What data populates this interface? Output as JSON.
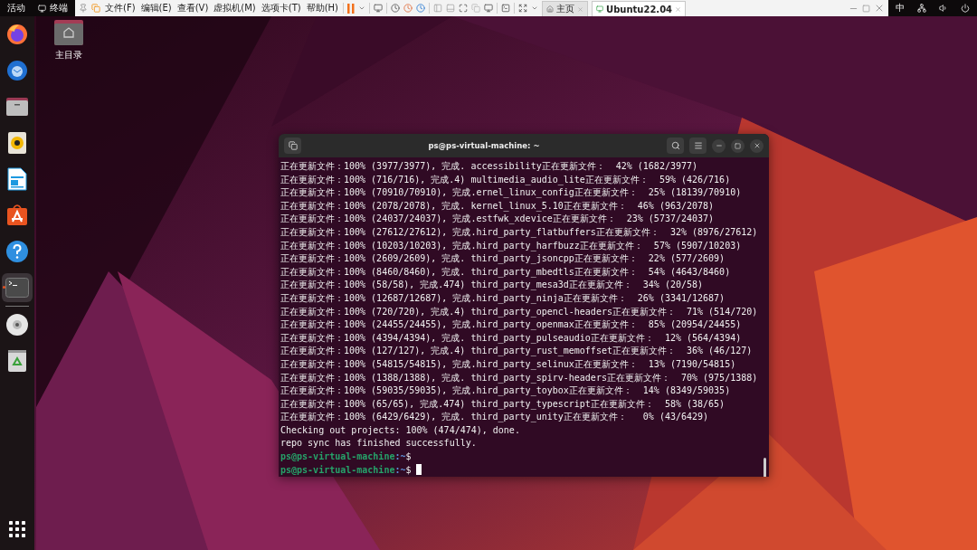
{
  "top_bar": {
    "activities": "活动",
    "app": "终端",
    "input_method": "中"
  },
  "vm_toolbar": {
    "menus": [
      "文件(F)",
      "编辑(E)",
      "查看(V)",
      "虚拟机(M)",
      "选项卡(T)",
      "帮助(H)"
    ],
    "tabs": [
      {
        "label": "主页",
        "selected": false
      },
      {
        "label": "Ubuntu22.04",
        "selected": true
      }
    ]
  },
  "dock": {
    "items": [
      {
        "kind": "firefox",
        "running": false
      },
      {
        "kind": "thunderbird",
        "running": false
      },
      {
        "kind": "files",
        "running": false
      },
      {
        "kind": "rhythmbox",
        "running": false
      },
      {
        "kind": "writer",
        "running": false
      },
      {
        "kind": "appcenter",
        "running": false
      },
      {
        "kind": "help",
        "running": false
      },
      {
        "kind": "terminal",
        "running": true
      },
      {
        "kind": "disc",
        "running": false
      },
      {
        "kind": "trash",
        "running": false
      }
    ]
  },
  "desktop": {
    "icons": [
      {
        "label": "主目录"
      }
    ]
  },
  "terminal": {
    "title": "ps@ps-virtual-machine: ~",
    "lines": [
      {
        "kind": "output",
        "text": "正在更新文件：100% (3977/3977), 完成. accessibility正在更新文件：  42% (1682/3977)"
      },
      {
        "kind": "output",
        "text": "正在更新文件：100% (716/716), 完成.4) multimedia_audio_lite正在更新文件：  59% (426/716)"
      },
      {
        "kind": "output",
        "text": "正在更新文件：100% (70910/70910), 完成.ernel_linux_config正在更新文件：  25% (18139/70910)"
      },
      {
        "kind": "output",
        "text": "正在更新文件：100% (2078/2078), 完成. kernel_linux_5.10正在更新文件：  46% (963/2078)"
      },
      {
        "kind": "output",
        "text": "正在更新文件：100% (24037/24037), 完成.estfwk_xdevice正在更新文件：  23% (5737/24037)"
      },
      {
        "kind": "output",
        "text": "正在更新文件：100% (27612/27612), 完成.hird_party_flatbuffers正在更新文件：  32% (8976/27612)"
      },
      {
        "kind": "output",
        "text": "正在更新文件：100% (10203/10203), 完成.hird_party_harfbuzz正在更新文件：  57% (5907/10203)"
      },
      {
        "kind": "output",
        "text": "正在更新文件：100% (2609/2609), 完成. third_party_jsoncpp正在更新文件：  22% (577/2609)"
      },
      {
        "kind": "output",
        "text": "正在更新文件：100% (8460/8460), 完成. third_party_mbedtls正在更新文件：  54% (4643/8460)"
      },
      {
        "kind": "output",
        "text": "正在更新文件：100% (58/58), 完成.474) third_party_mesa3d正在更新文件：  34% (20/58)"
      },
      {
        "kind": "output",
        "text": "正在更新文件：100% (12687/12687), 完成.hird_party_ninja正在更新文件：  26% (3341/12687)"
      },
      {
        "kind": "output",
        "text": "正在更新文件：100% (720/720), 完成.4) third_party_opencl-headers正在更新文件：  71% (514/720)"
      },
      {
        "kind": "output",
        "text": "正在更新文件：100% (24455/24455), 完成.hird_party_openmax正在更新文件：  85% (20954/24455)"
      },
      {
        "kind": "output",
        "text": "正在更新文件：100% (4394/4394), 完成. third_party_pulseaudio正在更新文件：  12% (564/4394)"
      },
      {
        "kind": "output",
        "text": "正在更新文件：100% (127/127), 完成.4) third_party_rust_memoffset正在更新文件：  36% (46/127)"
      },
      {
        "kind": "output",
        "text": "正在更新文件：100% (54815/54815), 完成.hird_party_selinux正在更新文件：  13% (7190/54815)"
      },
      {
        "kind": "output",
        "text": "正在更新文件：100% (1388/1388), 完成. third_party_spirv-headers正在更新文件：  70% (975/1388)"
      },
      {
        "kind": "output",
        "text": "正在更新文件：100% (59035/59035), 完成.hird_party_toybox正在更新文件：  14% (8349/59035)"
      },
      {
        "kind": "output",
        "text": "正在更新文件：100% (65/65), 完成.474) third_party_typescript正在更新文件：  58% (38/65)"
      },
      {
        "kind": "output",
        "text": "正在更新文件：100% (6429/6429), 完成. third_party_unity正在更新文件：   0% (43/6429)"
      },
      {
        "kind": "output",
        "text": "Checking out projects: 100% (474/474), done."
      },
      {
        "kind": "output",
        "text": "repo sync has finished successfully."
      },
      {
        "kind": "prompt",
        "user": "ps@ps-virtual-machine",
        "path": ":~",
        "symbol": "$",
        "cursor": false
      },
      {
        "kind": "prompt",
        "user": "ps@ps-virtual-machine",
        "path": ":~",
        "symbol": "$",
        "cursor": true
      }
    ]
  }
}
